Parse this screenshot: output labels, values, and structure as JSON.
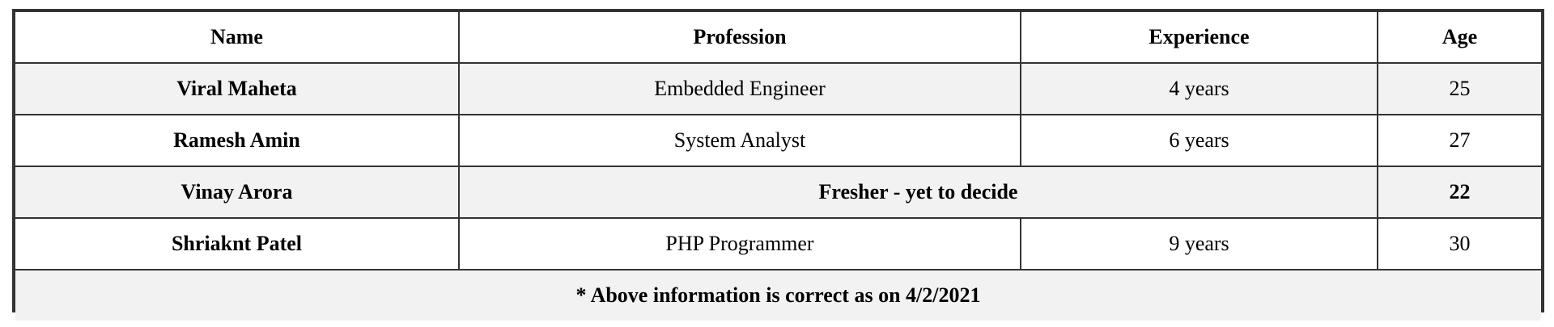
{
  "table": {
    "headers": {
      "name": "Name",
      "profession": "Profession",
      "experience": "Experience",
      "age": "Age"
    },
    "rows": [
      {
        "name": "Viral Maheta",
        "profession": "Embedded Engineer",
        "experience": "4 years",
        "age": "25"
      },
      {
        "name": "Ramesh Amin",
        "profession": "System Analyst",
        "experience": "6 years",
        "age": "27"
      },
      {
        "name": "Vinay Arora",
        "profession_experience_merged": "Fresher - yet to decide",
        "age": "22"
      },
      {
        "name": "Shriaknt Patel",
        "profession": "PHP Programmer",
        "experience": "9 years",
        "age": "30"
      }
    ],
    "footnote": "* Above information is correct as on 4/2/2021"
  },
  "colors": {
    "border": "#333333",
    "stripe": "#f2f2f2",
    "background": "#ffffff"
  }
}
